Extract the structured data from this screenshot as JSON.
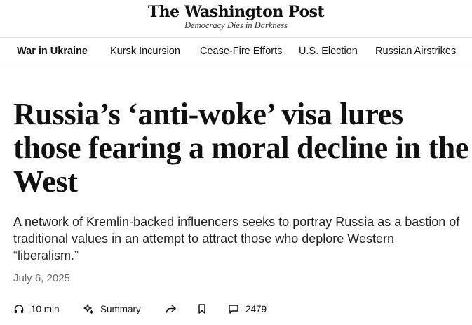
{
  "masthead": {
    "logo": "The Washington Post",
    "tagline": "Democracy Dies in Darkness"
  },
  "nav": {
    "items": [
      {
        "label": "War in Ukraine",
        "active": true
      },
      {
        "label": "Kursk Incursion"
      },
      {
        "label": "Cease-Fire Efforts"
      },
      {
        "label": "U.S. Election"
      },
      {
        "label": "Russian Airstrikes"
      }
    ]
  },
  "article": {
    "headline": "Russia’s ‘anti-woke’ visa lures those fearing a moral decline in the West",
    "dek": "A network of Kremlin-backed influencers seeks to portray Russia as a bastion of traditional values in an attempt to attract those who deplore Western “liberalism.”",
    "date": "July 6, 2025"
  },
  "actions": {
    "listen_icon": "headphones-icon",
    "listen_label": "10 min",
    "summary_icon": "sparkle-icon",
    "summary_label": "Summary",
    "share_icon": "share-arrow-icon",
    "save_icon": "bookmark-icon",
    "comments_icon": "comment-icon",
    "comments_count": "2479"
  }
}
